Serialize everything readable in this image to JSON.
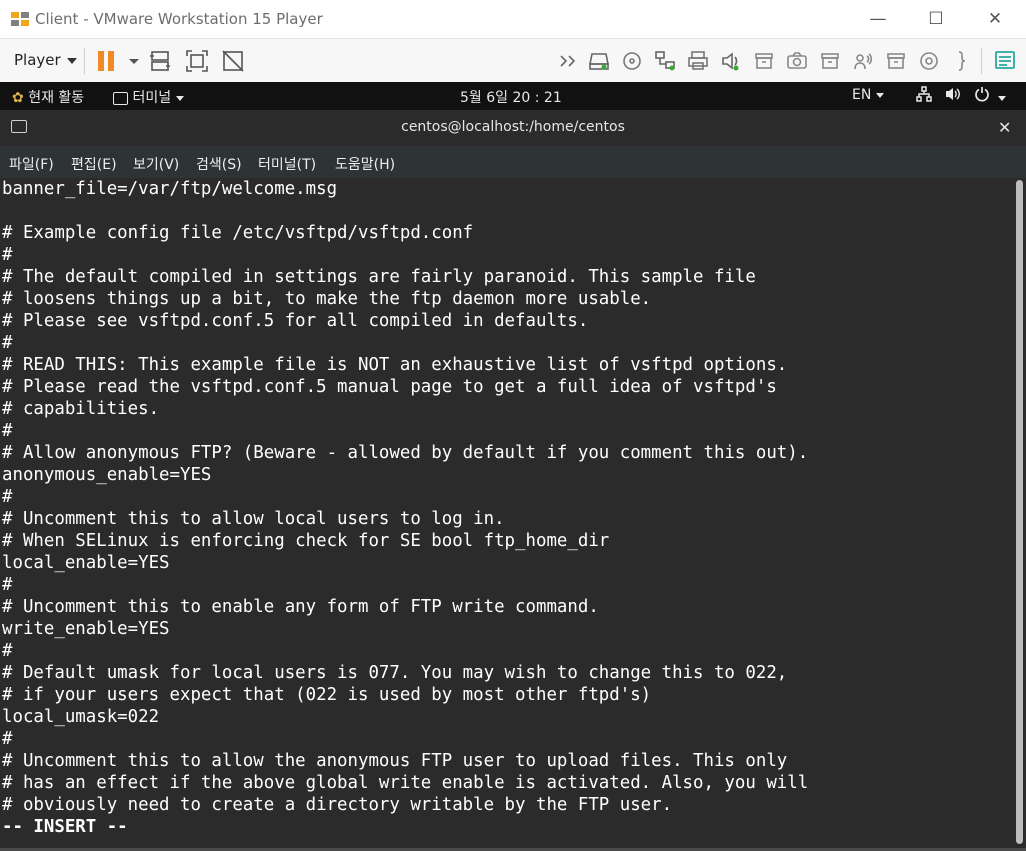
{
  "window": {
    "title": "Client - VMware Workstation 15 Player",
    "minimize": "—",
    "maximize": "☐",
    "close": "✕"
  },
  "toolbar": {
    "player_label": "Player",
    "icons": [
      "pause-icon",
      "dropdown-icon",
      "send-ctrl-alt-del-icon",
      "fit-guest-icon",
      "unity-icon",
      "more-devices-icon",
      "hard-disk-icon",
      "cd-dvd-icon",
      "network-adapter-icon",
      "printer-icon",
      "sound-card-icon",
      "usb-device-icon",
      "camera-icon",
      "usb-device-2-icon",
      "bluetooth-icon",
      "usb-device-3-icon",
      "floppy-icon",
      "brace-icon",
      "message-log-icon"
    ]
  },
  "gnome": {
    "activities": "현재 활동",
    "app_menu": "터미널",
    "clock": "5월 6일  20 : 21",
    "input_method": "EN"
  },
  "terminal": {
    "title": "centos@localhost:/home/centos",
    "close": "✕",
    "menu": [
      "파일(F)",
      "편집(E)",
      "보기(V)",
      "검색(S)",
      "터미널(T)",
      "도움말(H)"
    ],
    "lines": [
      "banner_file=/var/ftp/welcome.msg",
      "",
      "# Example config file /etc/vsftpd/vsftpd.conf",
      "#",
      "# The default compiled in settings are fairly paranoid. This sample file",
      "# loosens things up a bit, to make the ftp daemon more usable.",
      "# Please see vsftpd.conf.5 for all compiled in defaults.",
      "#",
      "# READ THIS: This example file is NOT an exhaustive list of vsftpd options.",
      "# Please read the vsftpd.conf.5 manual page to get a full idea of vsftpd's",
      "# capabilities.",
      "#",
      "# Allow anonymous FTP? (Beware - allowed by default if you comment this out).",
      "anonymous_enable=YES",
      "#",
      "# Uncomment this to allow local users to log in.",
      "# When SELinux is enforcing check for SE bool ftp_home_dir",
      "local_enable=YES",
      "#",
      "# Uncomment this to enable any form of FTP write command.",
      "write_enable=YES",
      "#",
      "# Default umask for local users is 077. You may wish to change this to 022,",
      "# if your users expect that (022 is used by most other ftpd's)",
      "local_umask=022",
      "#",
      "# Uncomment this to allow the anonymous FTP user to upload files. This only",
      "# has an effect if the above global write enable is activated. Also, you will",
      "# obviously need to create a directory writable by the FTP user."
    ],
    "mode_line": "-- INSERT --"
  },
  "colors": {
    "terminal_bg": "#2b2b2b",
    "terminal_fg": "#ffffff",
    "pause_orange": "#f08a24",
    "gnome_bar": "#111111"
  }
}
